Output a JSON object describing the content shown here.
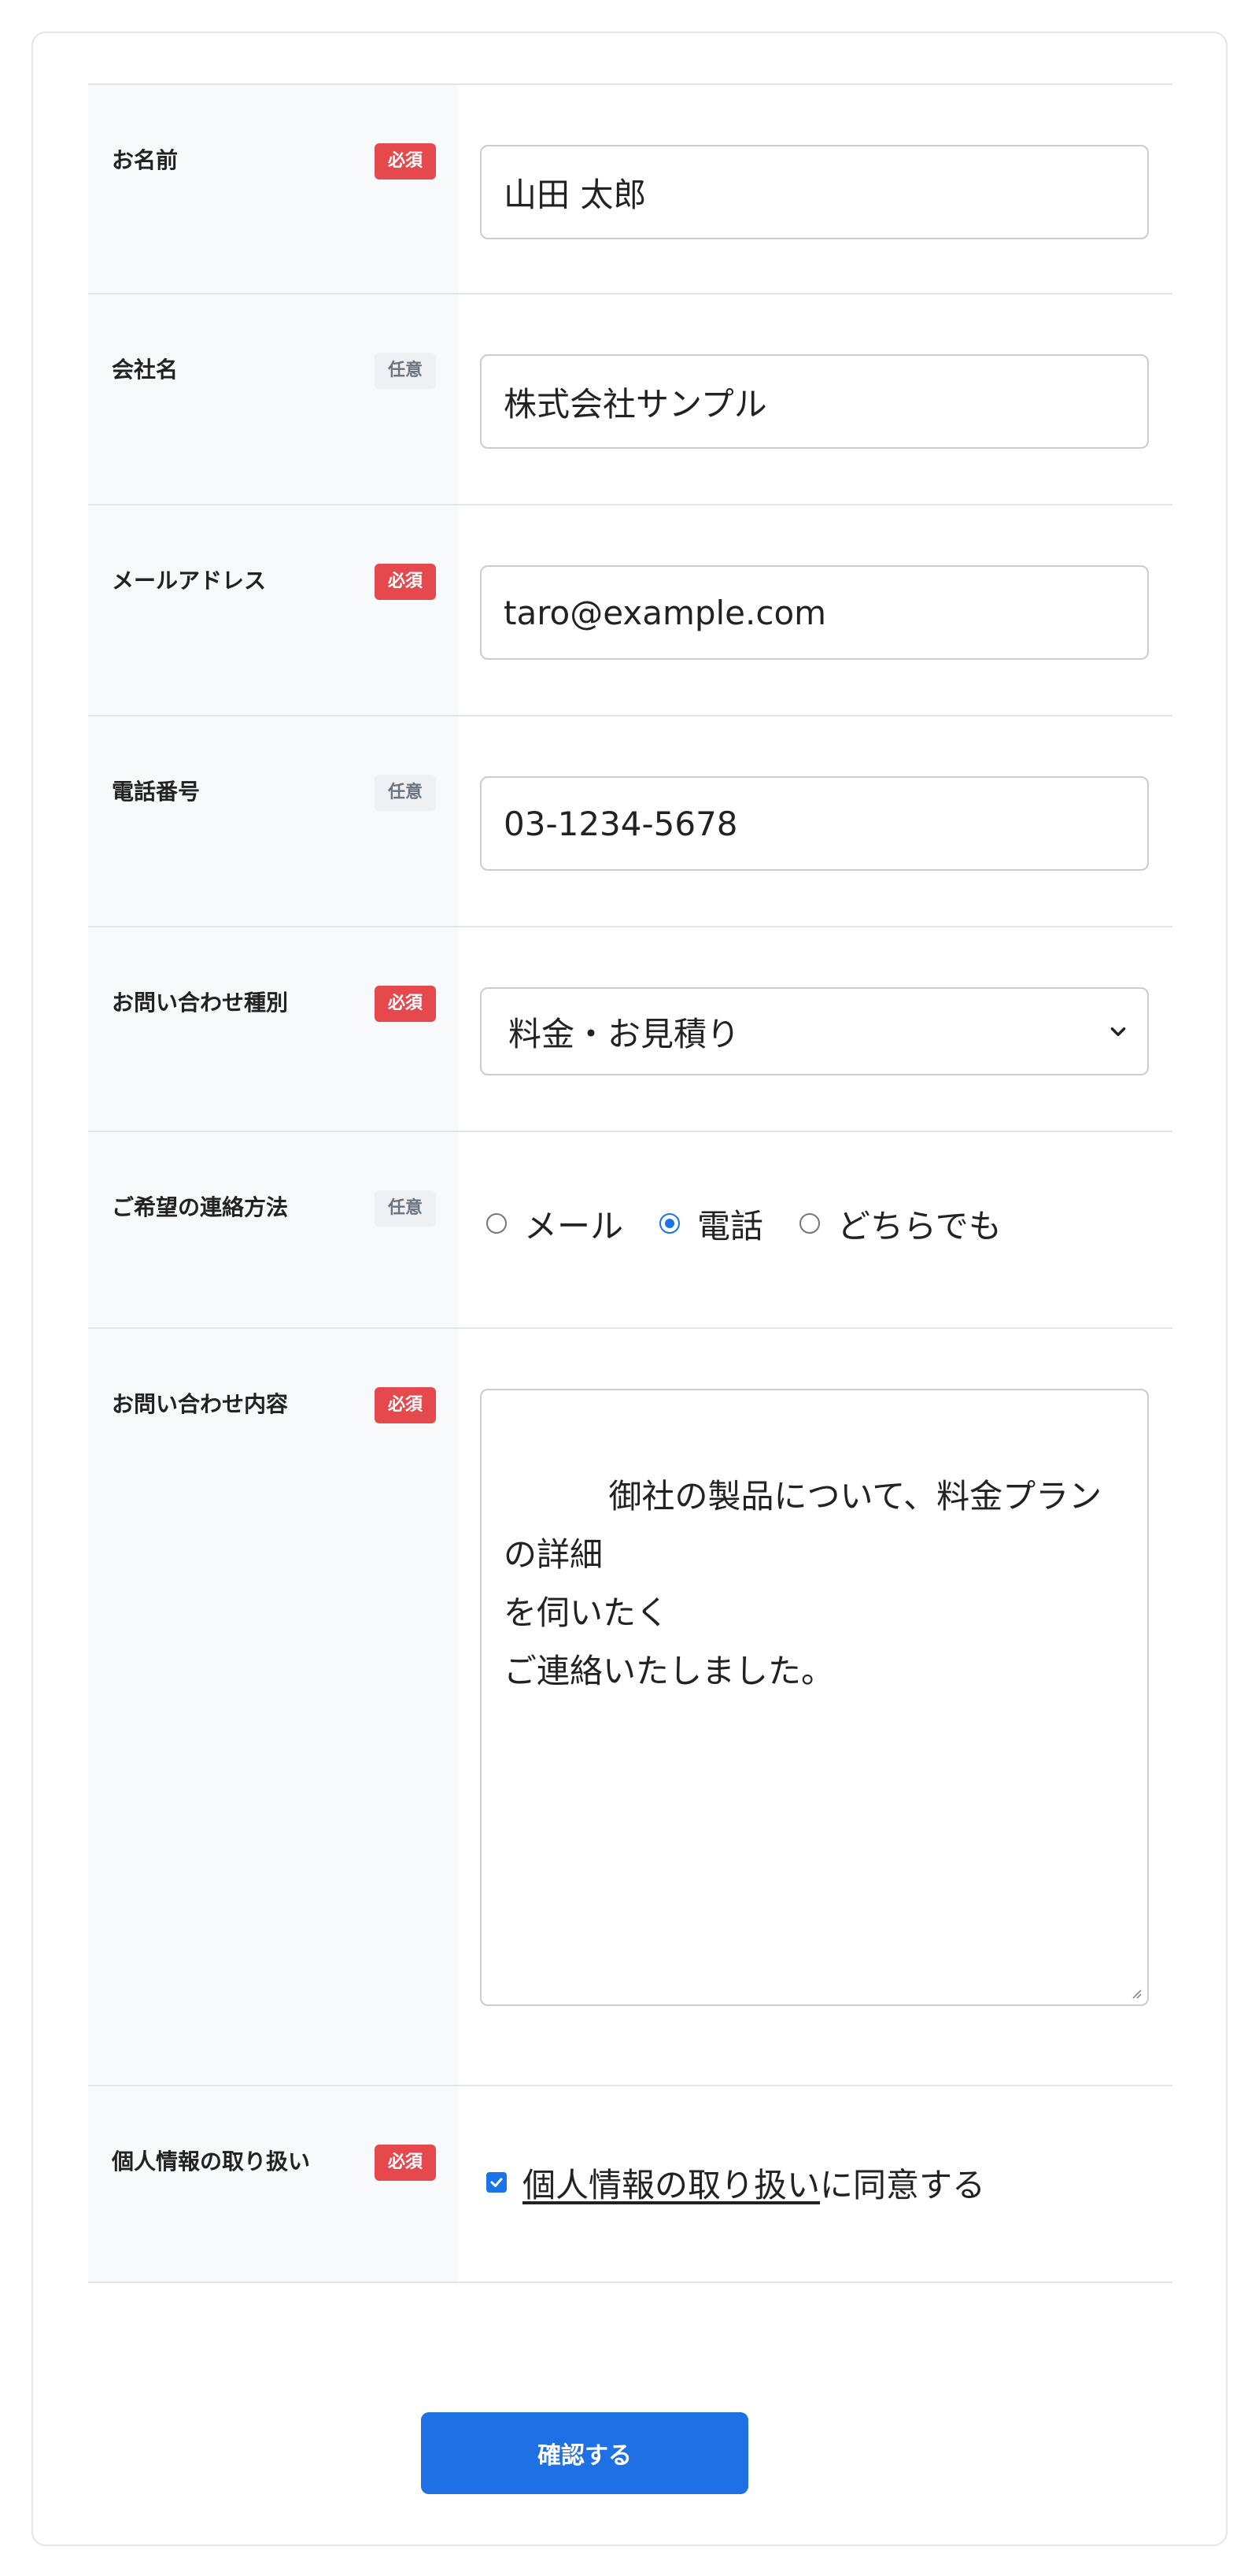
{
  "badges": {
    "required": "必須",
    "optional": "任意"
  },
  "fields": {
    "name": {
      "label": "お名前",
      "badge": "必須",
      "value": "山田 太郎"
    },
    "company": {
      "label": "会社名",
      "badge": "任意",
      "value": "株式会社サンプル"
    },
    "email": {
      "label": "メールアドレス",
      "badge": "必須",
      "value": "taro@example.com"
    },
    "phone": {
      "label": "電話番号",
      "badge": "任意",
      "value": "03-1234-5678"
    },
    "inquiry_type": {
      "label": "お問い合わせ種別",
      "badge": "必須",
      "selected": "料金・お見積り"
    },
    "contact_method": {
      "label": "ご希望の連絡方法",
      "badge": "任意",
      "options": [
        "メール",
        "電話",
        "どちらでも"
      ],
      "selected": "電話"
    },
    "message": {
      "label": "お問い合わせ内容",
      "badge": "必須",
      "value": "御社の製品について、料金プランの詳細\nを伺いたく\nご連絡いたしました。"
    },
    "privacy": {
      "label": "個人情報の取り扱い",
      "badge": "必須",
      "link_text": "個人情報の取り扱い",
      "suffix_text": "に同意する",
      "checked": true
    }
  },
  "submit": {
    "label": "確認する"
  },
  "colors": {
    "required_badge": "#e5484d",
    "optional_badge_bg": "#eef0f3",
    "accent": "#1f6fe5",
    "label_bg": "#f8f9fb"
  }
}
